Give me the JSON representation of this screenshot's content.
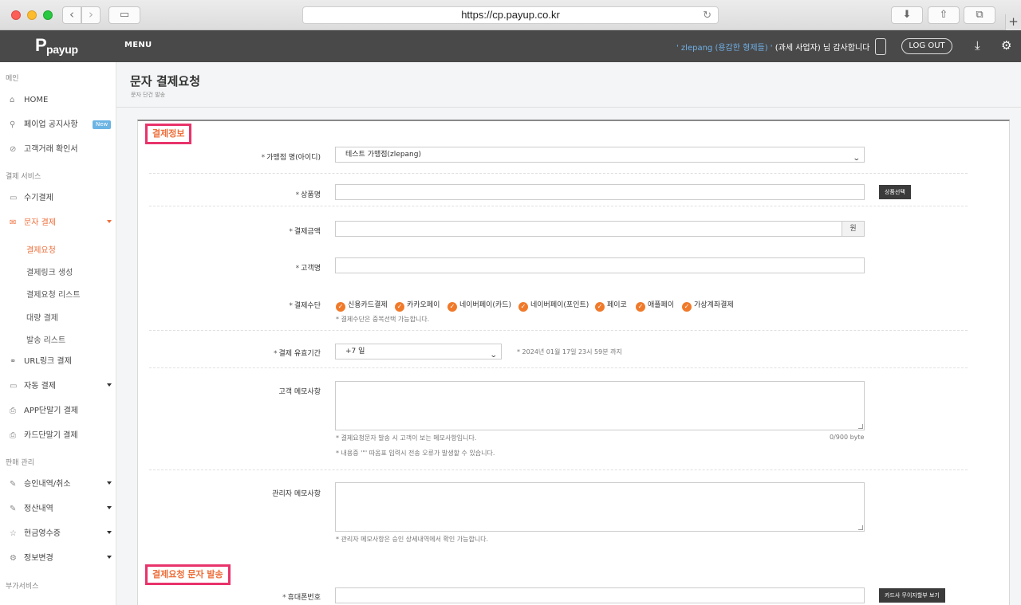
{
  "browser": {
    "url": "https://cp.payup.co.kr"
  },
  "header": {
    "logo": "payup",
    "menu": "MENU",
    "welcome_user": "' zlepang (용감한 형제들) '",
    "welcome_rest": "(과세 사업자) 님 감사합니다",
    "logout": "LOG OUT"
  },
  "sidebar": {
    "sections": [
      "메인",
      "결제 서비스",
      "판매 관리",
      "부가서비스"
    ],
    "main_items": [
      {
        "label": "HOME",
        "icon": "home-icon"
      },
      {
        "label": "페이업 공지사항",
        "icon": "pin-icon",
        "badge": "New"
      },
      {
        "label": "고객거래 확인서",
        "icon": "check-circle-icon"
      }
    ],
    "pay_items": [
      {
        "label": "수기결제",
        "icon": "card-icon"
      },
      {
        "label": "문자 결제",
        "icon": "mail-icon"
      }
    ],
    "sms_sub": [
      "결제요청",
      "결제링크 생성",
      "결제요청 리스트",
      "대량 결제",
      "발송 리스트"
    ],
    "pay_items2": [
      {
        "label": "URL링크 결제",
        "icon": "link-icon"
      },
      {
        "label": "자동 결제",
        "icon": "card-icon"
      },
      {
        "label": "APP단말기 결제",
        "icon": "printer-icon"
      },
      {
        "label": "카드단말기 결제",
        "icon": "printer-icon"
      }
    ],
    "sales_items": [
      {
        "label": "승인내역/취소",
        "icon": "edit-icon"
      },
      {
        "label": "정산내역",
        "icon": "edit-icon"
      },
      {
        "label": "현금영수증",
        "icon": "star-icon"
      },
      {
        "label": "정보변경",
        "icon": "gear-icon"
      }
    ]
  },
  "page": {
    "title": "문자 결제요청",
    "subtitle": "문자 단건 발송"
  },
  "form": {
    "section1": "결제정보",
    "section2": "결제요청 문자 발송",
    "merchant_label": "가맹점 명(아이디)",
    "merchant_value": "테스트 가맹점(zlepang)",
    "product_label": "상품명",
    "product_button": "상품선택",
    "amount_label": "결제금액",
    "amount_unit": "원",
    "customer_label": "고객명",
    "method_label": "결제수단",
    "methods": [
      "신용카드결제",
      "카카오페이",
      "네이버페이(카드)",
      "네이버페이(포인트)",
      "페이코",
      "애플페이",
      "가상계좌결제"
    ],
    "method_note": "* 결제수단은 중복선택 가능합니다.",
    "period_label": "결제 유효기간",
    "period_value": "+7 일",
    "period_note": "* 2024년 01월 17일 23시 59분 까지",
    "cust_memo_label": "고객 메모사항",
    "cust_memo_note1": "* 결제요청문자 발송 시 고객이 보는 메모사항입니다.",
    "cust_memo_note2": "* 내용중 '\"' 따옴표 입력시 전송 오류가 발생할 수 있습니다.",
    "cust_memo_count": "0/900 byte",
    "admin_memo_label": "관리자 메모사항",
    "admin_memo_note": "* 관리자 메모사항은 승인 상세내역에서 확인 가능합니다.",
    "phone_label": "휴대폰번호",
    "phone_button": "카드사 무이자할부 보기",
    "required_mark": "*"
  }
}
